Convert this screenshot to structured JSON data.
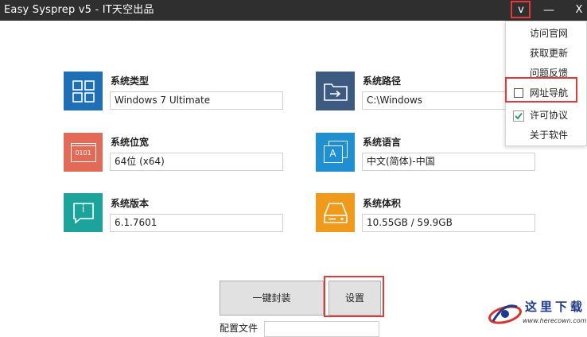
{
  "window": {
    "title": "Easy Sysprep v5 - IT天空出品",
    "menu_label": "v",
    "minimize_label": "—",
    "close_label": "X"
  },
  "items": [
    {
      "id": "os-type",
      "label": "系统类型",
      "value": "Windows 7 Ultimate",
      "icon": "windows-tiles-icon",
      "color": "#1e6fb5"
    },
    {
      "id": "os-path",
      "label": "系统路径",
      "value": "C:\\Windows",
      "icon": "folder-arrow-icon",
      "color": "#3d5a80"
    },
    {
      "id": "os-bits",
      "label": "系统位宽",
      "value": "64位 (x64)",
      "icon": "binary-icon",
      "color": "#e26a57"
    },
    {
      "id": "os-language",
      "label": "系统语言",
      "value": "中文(简体)-中国",
      "icon": "language-icon",
      "color": "#1e8fd0"
    },
    {
      "id": "os-version",
      "label": "系统版本",
      "value": "6.1.7601",
      "icon": "info-bubble-icon",
      "color": "#1ba39c"
    },
    {
      "id": "os-size",
      "label": "系统体积",
      "value": "10.55GB / 59.9GB",
      "icon": "hard-drive-icon",
      "color": "#ef9a1a"
    }
  ],
  "icon_text": {
    "binary": "0101",
    "language": "A",
    "info": "i"
  },
  "buttons": {
    "oneclick": "一键封装",
    "settings": "设置"
  },
  "config": {
    "label": "配置文件"
  },
  "menu": {
    "items": [
      {
        "label": "访问官网",
        "check": "none"
      },
      {
        "label": "获取更新",
        "check": "none"
      },
      {
        "label": "问题反馈",
        "check": "none"
      },
      {
        "label": "网址导航",
        "check": "unchecked"
      },
      {
        "label": "许可协议",
        "check": "checked"
      },
      {
        "label": "关于软件",
        "check": "none"
      }
    ]
  },
  "watermark": {
    "title": "这里下载",
    "url": "www.herecown.com"
  },
  "colors": {
    "titlebar": "#2f2f2f",
    "highlight": "#e23a3a",
    "check": "#2e9e5b"
  }
}
